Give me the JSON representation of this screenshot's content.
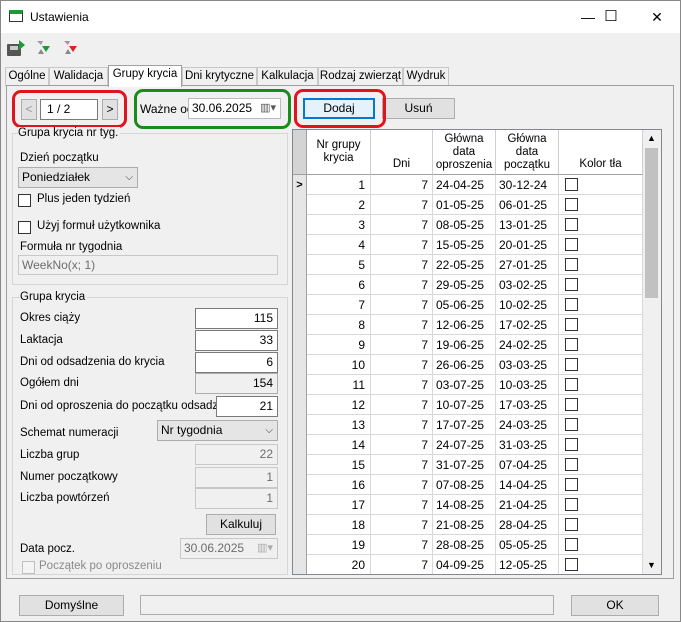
{
  "window": {
    "title": "Ustawienia",
    "controls": {
      "minimize": "—",
      "maximize": "☐",
      "close": "✕"
    }
  },
  "toolbar": {
    "icons": [
      "save-icon",
      "refresh-icon",
      "undo-icon"
    ]
  },
  "tabs": [
    {
      "label": "Ogólne",
      "active": false
    },
    {
      "label": "Walidacja",
      "active": false
    },
    {
      "label": "Grupy krycia",
      "active": true
    },
    {
      "label": "Dni krytyczne",
      "active": false
    },
    {
      "label": "Kalkulacja",
      "active": false
    },
    {
      "label": "Rodzaj zwierząt",
      "active": false
    },
    {
      "label": "Wydruk",
      "active": false
    }
  ],
  "navigator": {
    "prev": "<",
    "position": "1 / 2",
    "next": ">"
  },
  "valid_from": {
    "label": "Ważne od",
    "value": "30.06.2025"
  },
  "actions": {
    "add": "Dodaj",
    "remove": "Usuń"
  },
  "week_group": {
    "title": "Grupa krycia nr tyg.",
    "start_day_label": "Dzień początku",
    "start_day_value": "Poniedziałek",
    "plus_one_week": "Plus jeden tydzień",
    "use_formula": "Użyj formuł użytkownika",
    "formula_label": "Formuła nr tygodnia",
    "formula_value": "WeekNo(x; 1)"
  },
  "group": {
    "title": "Grupa krycia",
    "pregnancy_label": "Okres ciąży",
    "pregnancy_value": "115",
    "lactation_label": "Laktacja",
    "lactation_value": "33",
    "weaning_label": "Dni od odsadzenia do krycia",
    "weaning_value": "6",
    "total_label": "Ogółem dni",
    "total_value": "154",
    "farrow_label": "Dni od oproszenia do początku odsadzeń",
    "farrow_value": "21",
    "scheme_label": "Schemat numeracji",
    "scheme_value": "Nr tygodnia",
    "groups_count_label": "Liczba grup",
    "groups_count_value": "22",
    "start_number_label": "Numer początkowy",
    "start_number_value": "1",
    "repeats_label": "Liczba powtórzeń",
    "repeats_value": "1",
    "calculate": "Kalkuluj",
    "start_date_label": "Data pocz.",
    "start_date_value": "30.06.2025",
    "from_farrowing": "Początek po oproszeniu"
  },
  "table": {
    "headers": [
      "Nr grupy krycia",
      "Dni",
      "Główna data oproszenia",
      "Główna data początku",
      "Kolor tła"
    ],
    "current_row_marker": ">",
    "rows": [
      {
        "nr": "1",
        "dni": "7",
        "oproszenie": "24-04-25",
        "poczatek": "30-12-24"
      },
      {
        "nr": "2",
        "dni": "7",
        "oproszenie": "01-05-25",
        "poczatek": "06-01-25"
      },
      {
        "nr": "3",
        "dni": "7",
        "oproszenie": "08-05-25",
        "poczatek": "13-01-25"
      },
      {
        "nr": "4",
        "dni": "7",
        "oproszenie": "15-05-25",
        "poczatek": "20-01-25"
      },
      {
        "nr": "5",
        "dni": "7",
        "oproszenie": "22-05-25",
        "poczatek": "27-01-25"
      },
      {
        "nr": "6",
        "dni": "7",
        "oproszenie": "29-05-25",
        "poczatek": "03-02-25"
      },
      {
        "nr": "7",
        "dni": "7",
        "oproszenie": "05-06-25",
        "poczatek": "10-02-25"
      },
      {
        "nr": "8",
        "dni": "7",
        "oproszenie": "12-06-25",
        "poczatek": "17-02-25"
      },
      {
        "nr": "9",
        "dni": "7",
        "oproszenie": "19-06-25",
        "poczatek": "24-02-25"
      },
      {
        "nr": "10",
        "dni": "7",
        "oproszenie": "26-06-25",
        "poczatek": "03-03-25"
      },
      {
        "nr": "11",
        "dni": "7",
        "oproszenie": "03-07-25",
        "poczatek": "10-03-25"
      },
      {
        "nr": "12",
        "dni": "7",
        "oproszenie": "10-07-25",
        "poczatek": "17-03-25"
      },
      {
        "nr": "13",
        "dni": "7",
        "oproszenie": "17-07-25",
        "poczatek": "24-03-25"
      },
      {
        "nr": "14",
        "dni": "7",
        "oproszenie": "24-07-25",
        "poczatek": "31-03-25"
      },
      {
        "nr": "15",
        "dni": "7",
        "oproszenie": "31-07-25",
        "poczatek": "07-04-25"
      },
      {
        "nr": "16",
        "dni": "7",
        "oproszenie": "07-08-25",
        "poczatek": "14-04-25"
      },
      {
        "nr": "17",
        "dni": "7",
        "oproszenie": "14-08-25",
        "poczatek": "21-04-25"
      },
      {
        "nr": "18",
        "dni": "7",
        "oproszenie": "21-08-25",
        "poczatek": "28-04-25"
      },
      {
        "nr": "19",
        "dni": "7",
        "oproszenie": "28-08-25",
        "poczatek": "05-05-25"
      },
      {
        "nr": "20",
        "dni": "7",
        "oproszenie": "04-09-25",
        "poczatek": "12-05-25"
      }
    ]
  },
  "footer": {
    "defaults": "Domyślne",
    "ok": "OK"
  },
  "colors": {
    "highlight_red": "#e0141e",
    "highlight_green": "#1a8a1a",
    "focus_blue": "#0078d7"
  }
}
